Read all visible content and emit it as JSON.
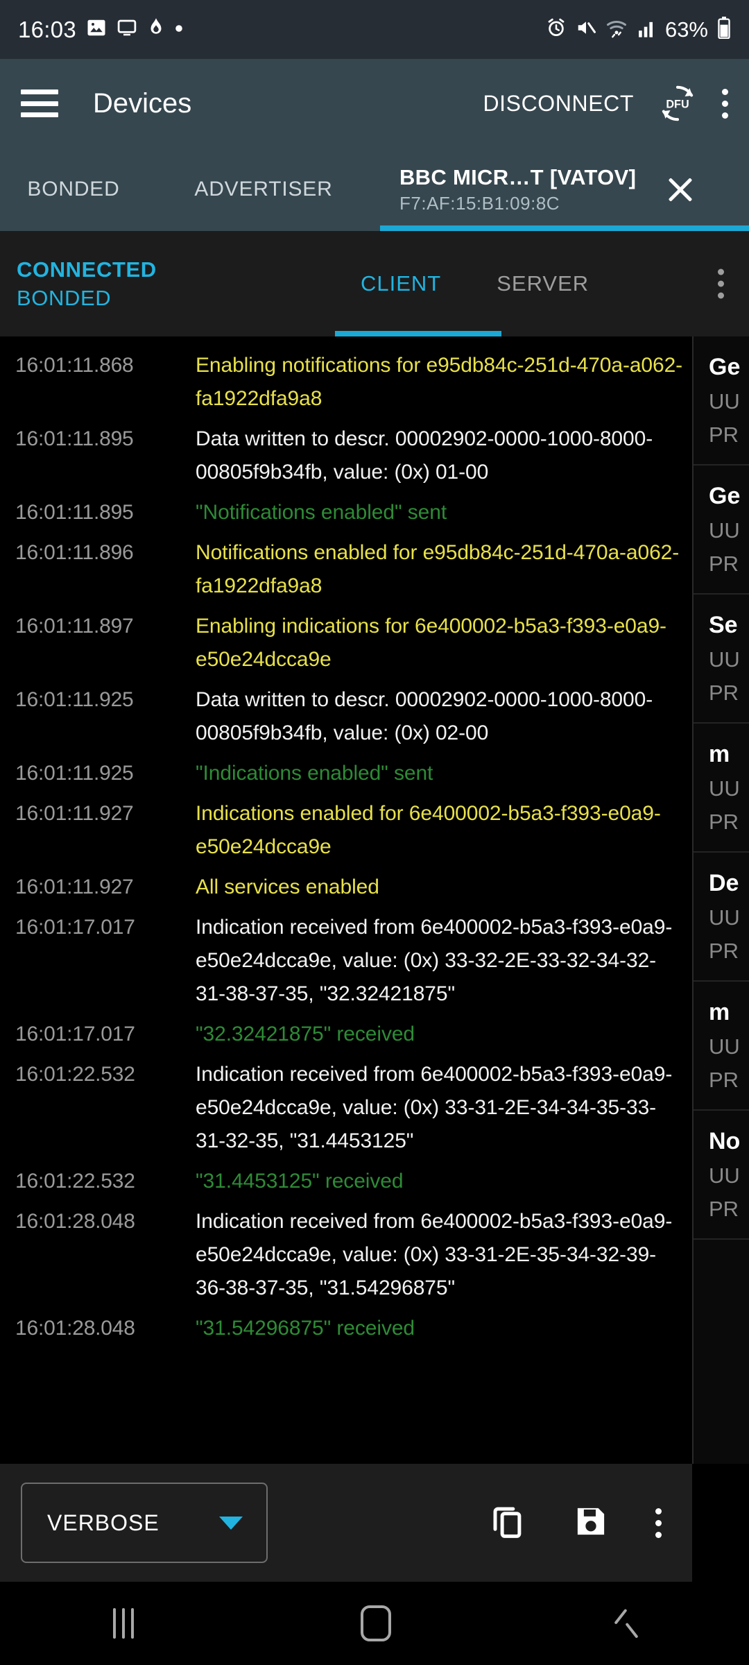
{
  "status_bar": {
    "time": "16:03",
    "battery_percent": "63%",
    "left_icons": [
      "image-icon",
      "monitor-icon",
      "mobile-data-saver-icon",
      "dot-icon"
    ],
    "right_icons": [
      "alarm-icon",
      "mute-icon",
      "wifi-icon",
      "signal-icon",
      "battery-icon"
    ]
  },
  "app_bar": {
    "menu_icon": "hamburger-menu-icon",
    "title": "Devices",
    "disconnect_label": "DISCONNECT",
    "dfu_label": "DFU",
    "overflow_icon": "overflow-menu-icon"
  },
  "device_tabs": {
    "bonded_label": "BONDED",
    "advertiser_label": "ADVERTISER",
    "active_device_name": "BBC MICR…T [VATOV]",
    "active_device_mac": "F7:AF:15:B1:09:8C",
    "close_icon": "close-icon",
    "indicator_color": "#1ba8d4"
  },
  "connection_bar": {
    "state_line1": "CONNECTED",
    "state_line2": "BONDED",
    "state_color": "#22b4e0",
    "tabs": [
      {
        "label": "CLIENT",
        "active": true
      },
      {
        "label": "SERVER",
        "active": false
      }
    ],
    "overflow_icon": "overflow-menu-icon"
  },
  "log": {
    "entries": [
      {
        "time": "16:01:11.868",
        "text": "Enabling notifications for e95db84c-251d-470a-a062-fa1922dfa9a8",
        "level": "yellow"
      },
      {
        "time": "16:01:11.895",
        "text": "Data written to descr. 00002902-0000-1000-8000-00805f9b34fb, value: (0x) 01-00",
        "level": "white"
      },
      {
        "time": "16:01:11.895",
        "text": "\"Notifications enabled\" sent",
        "level": "green"
      },
      {
        "time": "16:01:11.896",
        "text": "Notifications enabled for e95db84c-251d-470a-a062-fa1922dfa9a8",
        "level": "yellow"
      },
      {
        "time": "16:01:11.897",
        "text": "Enabling indications for 6e400002-b5a3-f393-e0a9-e50e24dcca9e",
        "level": "yellow"
      },
      {
        "time": "16:01:11.925",
        "text": "Data written to descr. 00002902-0000-1000-8000-00805f9b34fb, value: (0x) 02-00",
        "level": "white"
      },
      {
        "time": "16:01:11.925",
        "text": "\"Indications enabled\" sent",
        "level": "green"
      },
      {
        "time": "16:01:11.927",
        "text": "Indications enabled for 6e400002-b5a3-f393-e0a9-e50e24dcca9e",
        "level": "yellow"
      },
      {
        "time": "16:01:11.927",
        "text": "All services enabled",
        "level": "yellow"
      },
      {
        "time": "16:01:17.017",
        "text": "Indication received from 6e400002-b5a3-f393-e0a9-e50e24dcca9e, value: (0x) 33-32-2E-33-32-34-32-31-38-37-35, \"32.32421875\"",
        "level": "white"
      },
      {
        "time": "16:01:17.017",
        "text": "\"32.32421875\" received",
        "level": "green"
      },
      {
        "time": "16:01:22.532",
        "text": "Indication received from 6e400002-b5a3-f393-e0a9-e50e24dcca9e, value: (0x) 33-31-2E-34-34-35-33-31-32-35, \"31.4453125\"",
        "level": "white"
      },
      {
        "time": "16:01:22.532",
        "text": "\"31.4453125\" received",
        "level": "green"
      },
      {
        "time": "16:01:28.048",
        "text": "Indication received from 6e400002-b5a3-f393-e0a9-e50e24dcca9e, value: (0x) 33-31-2E-35-34-32-39-36-38-37-35, \"31.54296875\"",
        "level": "white"
      },
      {
        "time": "16:01:28.048",
        "text": "\"31.54296875\" received",
        "level": "green"
      }
    ],
    "colors": {
      "timestamp": "#9a9a9a",
      "white": "#f2f2f2",
      "yellow": "#e8e14a",
      "green": "#2e8b36"
    }
  },
  "services_panel": {
    "items": [
      {
        "name": "Ge",
        "uuid": "UU",
        "primary": "PR"
      },
      {
        "name": "Ge",
        "uuid": "UU",
        "primary": "PR"
      },
      {
        "name": "Se",
        "uuid": "UU",
        "primary": "PR"
      },
      {
        "name": "m",
        "uuid": "UU",
        "primary": "PR"
      },
      {
        "name": "De",
        "uuid": "UU",
        "primary": "PR"
      },
      {
        "name": "m",
        "uuid": "UU",
        "primary": "PR"
      },
      {
        "name": "No",
        "uuid": "UU",
        "primary": "PR"
      }
    ]
  },
  "bottom_toolbar": {
    "log_level": "VERBOSE",
    "caret_icon": "chevron-down-icon",
    "caret_color": "#22b4e0",
    "copy_icon": "copy-icon",
    "save_icon": "save-icon",
    "overflow_icon": "overflow-menu-icon"
  },
  "nav_bar": {
    "recents_icon": "recents-icon",
    "home_icon": "home-icon",
    "back_icon": "back-icon"
  }
}
